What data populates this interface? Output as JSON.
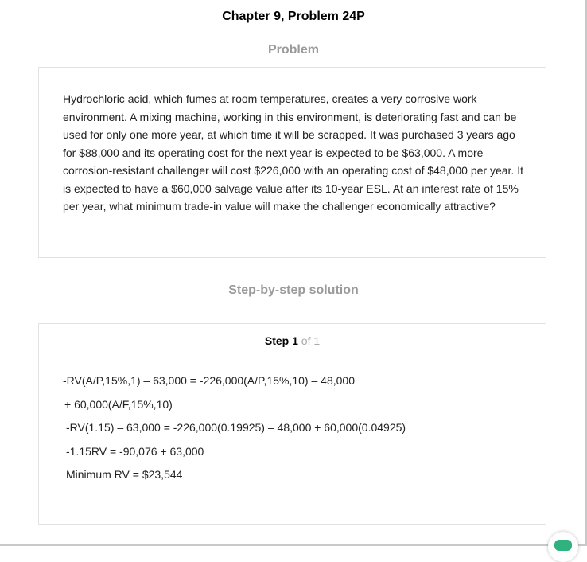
{
  "header": {
    "title": "Chapter 9, Problem 24P"
  },
  "problem": {
    "heading": "Problem",
    "text": "Hydrochloric acid, which fumes at room temperatures, creates a very corrosive work environment. A mixing machine, working in this environment, is deteriorating fast and can be used for only one more year, at which time it will be scrapped. It was purchased 3 years ago for $88,000 and its operating cost for the next year is expected to be $63,000. A more corrosion-resistant challenger will cost $226,000 with an operating cost of $48,000 per year. It is expected to have a $60,000 salvage value after its 10-year ESL. At an interest rate of 15% per year, what minimum trade-in value will make the challenger economically attractive?"
  },
  "solution": {
    "heading": "Step-by-step solution",
    "step_word": "Step",
    "step_number": "1",
    "step_of": "of 1",
    "lines": [
      "-RV(A/P,15%,1) – 63,000 = -226,000(A/P,15%,10) – 48,000",
      " + 60,000(A/F,15%,10)",
      "-RV(1.15) – 63,000 = -226,000(0.19925) – 48,000 + 60,000(0.04925)",
      "-1.15RV = -90,076 + 63,000",
      "Minimum RV = $23,544"
    ]
  },
  "chat": {
    "icon": "chat-icon"
  }
}
